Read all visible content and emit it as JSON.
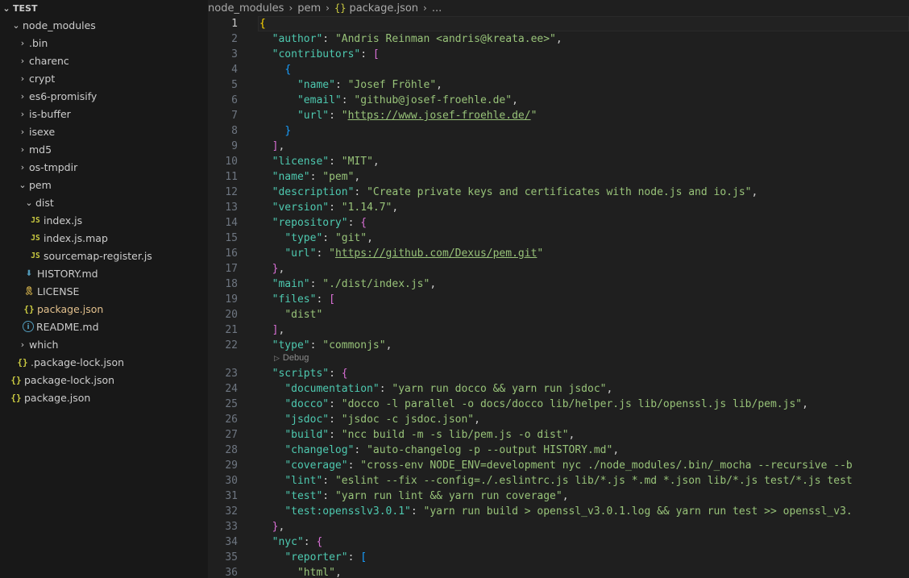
{
  "explorer": {
    "root_label": "TEST",
    "items": [
      {
        "label": "node_modules",
        "kind": "folder",
        "open": true,
        "depth": 0
      },
      {
        "label": ".bin",
        "kind": "folder",
        "open": false,
        "depth": 1
      },
      {
        "label": "charenc",
        "kind": "folder",
        "open": false,
        "depth": 1
      },
      {
        "label": "crypt",
        "kind": "folder",
        "open": false,
        "depth": 1
      },
      {
        "label": "es6-promisify",
        "kind": "folder",
        "open": false,
        "depth": 1
      },
      {
        "label": "is-buffer",
        "kind": "folder",
        "open": false,
        "depth": 1
      },
      {
        "label": "isexe",
        "kind": "folder",
        "open": false,
        "depth": 1
      },
      {
        "label": "md5",
        "kind": "folder",
        "open": false,
        "depth": 1
      },
      {
        "label": "os-tmpdir",
        "kind": "folder",
        "open": false,
        "depth": 1
      },
      {
        "label": "pem",
        "kind": "folder",
        "open": true,
        "depth": 1
      },
      {
        "label": "dist",
        "kind": "folder",
        "open": true,
        "depth": 2
      },
      {
        "label": "index.js",
        "kind": "js",
        "depth": 3
      },
      {
        "label": "index.js.map",
        "kind": "js",
        "depth": 3
      },
      {
        "label": "sourcemap-register.js",
        "kind": "js",
        "depth": 3
      },
      {
        "label": "HISTORY.md",
        "kind": "md-down",
        "depth": 2
      },
      {
        "label": "LICENSE",
        "kind": "license",
        "depth": 2
      },
      {
        "label": "package.json",
        "kind": "json",
        "depth": 2,
        "active": true
      },
      {
        "label": "README.md",
        "kind": "info",
        "depth": 2
      },
      {
        "label": "which",
        "kind": "folder",
        "open": false,
        "depth": 1
      },
      {
        "label": ".package-lock.json",
        "kind": "json",
        "depth": 1
      },
      {
        "label": "package-lock.json",
        "kind": "json",
        "depth": 0
      },
      {
        "label": "package.json",
        "kind": "json",
        "depth": 0
      }
    ],
    "icons": {
      "js": "JS",
      "json": "{}",
      "md-down": "⬇",
      "license": "🎗",
      "info": "i"
    }
  },
  "breadcrumb": {
    "parts": [
      "node_modules",
      "pem"
    ],
    "file_icon": "{}",
    "file": "package.json",
    "more": "..."
  },
  "editor": {
    "current_line": 1,
    "codelens": {
      "play_icon": "▷",
      "label": "Debug",
      "after_line": 22
    },
    "lines": [
      [
        [
          "b1",
          "{"
        ]
      ],
      [
        [
          "p",
          "  "
        ],
        [
          "k",
          "\"author\""
        ],
        [
          "p",
          ": "
        ],
        [
          "s",
          "\"Andris Reinman <andris@kreata.ee>\""
        ],
        [
          "p",
          ","
        ]
      ],
      [
        [
          "p",
          "  "
        ],
        [
          "k",
          "\"contributors\""
        ],
        [
          "p",
          ": "
        ],
        [
          "b2",
          "["
        ]
      ],
      [
        [
          "p",
          "    "
        ],
        [
          "b3",
          "{"
        ]
      ],
      [
        [
          "p",
          "      "
        ],
        [
          "k",
          "\"name\""
        ],
        [
          "p",
          ": "
        ],
        [
          "s",
          "\"Josef Fröhle\""
        ],
        [
          "p",
          ","
        ]
      ],
      [
        [
          "p",
          "      "
        ],
        [
          "k",
          "\"email\""
        ],
        [
          "p",
          ": "
        ],
        [
          "s",
          "\"github@josef-froehle.de\""
        ],
        [
          "p",
          ","
        ]
      ],
      [
        [
          "p",
          "      "
        ],
        [
          "k",
          "\"url\""
        ],
        [
          "p",
          ": "
        ],
        [
          "s",
          "\""
        ],
        [
          "link",
          "https://www.josef-froehle.de/"
        ],
        [
          "s",
          "\""
        ]
      ],
      [
        [
          "p",
          "    "
        ],
        [
          "b3",
          "}"
        ]
      ],
      [
        [
          "p",
          "  "
        ],
        [
          "b2",
          "]"
        ],
        [
          "p",
          ","
        ]
      ],
      [
        [
          "p",
          "  "
        ],
        [
          "k",
          "\"license\""
        ],
        [
          "p",
          ": "
        ],
        [
          "s",
          "\"MIT\""
        ],
        [
          "p",
          ","
        ]
      ],
      [
        [
          "p",
          "  "
        ],
        [
          "k",
          "\"name\""
        ],
        [
          "p",
          ": "
        ],
        [
          "s",
          "\"pem\""
        ],
        [
          "p",
          ","
        ]
      ],
      [
        [
          "p",
          "  "
        ],
        [
          "k",
          "\"description\""
        ],
        [
          "p",
          ": "
        ],
        [
          "s",
          "\"Create private keys and certificates with node.js and io.js\""
        ],
        [
          "p",
          ","
        ]
      ],
      [
        [
          "p",
          "  "
        ],
        [
          "k",
          "\"version\""
        ],
        [
          "p",
          ": "
        ],
        [
          "s",
          "\"1.14.7\""
        ],
        [
          "p",
          ","
        ]
      ],
      [
        [
          "p",
          "  "
        ],
        [
          "k",
          "\"repository\""
        ],
        [
          "p",
          ": "
        ],
        [
          "b2",
          "{"
        ]
      ],
      [
        [
          "p",
          "    "
        ],
        [
          "k",
          "\"type\""
        ],
        [
          "p",
          ": "
        ],
        [
          "s",
          "\"git\""
        ],
        [
          "p",
          ","
        ]
      ],
      [
        [
          "p",
          "    "
        ],
        [
          "k",
          "\"url\""
        ],
        [
          "p",
          ": "
        ],
        [
          "s",
          "\""
        ],
        [
          "link",
          "https://github.com/Dexus/pem.git"
        ],
        [
          "s",
          "\""
        ]
      ],
      [
        [
          "p",
          "  "
        ],
        [
          "b2",
          "}"
        ],
        [
          "p",
          ","
        ]
      ],
      [
        [
          "p",
          "  "
        ],
        [
          "k",
          "\"main\""
        ],
        [
          "p",
          ": "
        ],
        [
          "s",
          "\"./dist/index.js\""
        ],
        [
          "p",
          ","
        ]
      ],
      [
        [
          "p",
          "  "
        ],
        [
          "k",
          "\"files\""
        ],
        [
          "p",
          ": "
        ],
        [
          "b2",
          "["
        ]
      ],
      [
        [
          "p",
          "    "
        ],
        [
          "s",
          "\"dist\""
        ]
      ],
      [
        [
          "p",
          "  "
        ],
        [
          "b2",
          "]"
        ],
        [
          "p",
          ","
        ]
      ],
      [
        [
          "p",
          "  "
        ],
        [
          "k",
          "\"type\""
        ],
        [
          "p",
          ": "
        ],
        [
          "s",
          "\"commonjs\""
        ],
        [
          "p",
          ","
        ]
      ],
      [
        [
          "p",
          "  "
        ],
        [
          "k",
          "\"scripts\""
        ],
        [
          "p",
          ": "
        ],
        [
          "b2",
          "{"
        ]
      ],
      [
        [
          "p",
          "    "
        ],
        [
          "k",
          "\"documentation\""
        ],
        [
          "p",
          ": "
        ],
        [
          "s",
          "\"yarn run docco && yarn run jsdoc\""
        ],
        [
          "p",
          ","
        ]
      ],
      [
        [
          "p",
          "    "
        ],
        [
          "k",
          "\"docco\""
        ],
        [
          "p",
          ": "
        ],
        [
          "s",
          "\"docco -l parallel -o docs/docco lib/helper.js lib/openssl.js lib/pem.js\""
        ],
        [
          "p",
          ","
        ]
      ],
      [
        [
          "p",
          "    "
        ],
        [
          "k",
          "\"jsdoc\""
        ],
        [
          "p",
          ": "
        ],
        [
          "s",
          "\"jsdoc -c jsdoc.json\""
        ],
        [
          "p",
          ","
        ]
      ],
      [
        [
          "p",
          "    "
        ],
        [
          "k",
          "\"build\""
        ],
        [
          "p",
          ": "
        ],
        [
          "s",
          "\"ncc build -m -s lib/pem.js -o dist\""
        ],
        [
          "p",
          ","
        ]
      ],
      [
        [
          "p",
          "    "
        ],
        [
          "k",
          "\"changelog\""
        ],
        [
          "p",
          ": "
        ],
        [
          "s",
          "\"auto-changelog -p --output HISTORY.md\""
        ],
        [
          "p",
          ","
        ]
      ],
      [
        [
          "p",
          "    "
        ],
        [
          "k",
          "\"coverage\""
        ],
        [
          "p",
          ": "
        ],
        [
          "s",
          "\"cross-env NODE_ENV=development nyc ./node_modules/.bin/_mocha --recursive --b"
        ]
      ],
      [
        [
          "p",
          "    "
        ],
        [
          "k",
          "\"lint\""
        ],
        [
          "p",
          ": "
        ],
        [
          "s",
          "\"eslint --fix --config=./.eslintrc.js lib/*.js *.md *.json lib/*.js test/*.js test"
        ]
      ],
      [
        [
          "p",
          "    "
        ],
        [
          "k",
          "\"test\""
        ],
        [
          "p",
          ": "
        ],
        [
          "s",
          "\"yarn run lint && yarn run coverage\""
        ],
        [
          "p",
          ","
        ]
      ],
      [
        [
          "p",
          "    "
        ],
        [
          "k",
          "\"test:opensslv3.0.1\""
        ],
        [
          "p",
          ": "
        ],
        [
          "s",
          "\"yarn run build > openssl_v3.0.1.log && yarn run test >> openssl_v3."
        ]
      ],
      [
        [
          "p",
          "  "
        ],
        [
          "b2",
          "}"
        ],
        [
          "p",
          ","
        ]
      ],
      [
        [
          "p",
          "  "
        ],
        [
          "k",
          "\"nyc\""
        ],
        [
          "p",
          ": "
        ],
        [
          "b2",
          "{"
        ]
      ],
      [
        [
          "p",
          "    "
        ],
        [
          "k",
          "\"reporter\""
        ],
        [
          "p",
          ": "
        ],
        [
          "b3",
          "["
        ]
      ],
      [
        [
          "p",
          "      "
        ],
        [
          "s",
          "\"html\""
        ],
        [
          "p",
          ","
        ]
      ]
    ]
  },
  "colors": {
    "json_key": "#4ec9b0",
    "json_string": "#98c379",
    "bracket_1": "#ffd700",
    "bracket_2": "#da70d6",
    "bracket_3": "#179fff",
    "active_file": "#e2c08d"
  }
}
